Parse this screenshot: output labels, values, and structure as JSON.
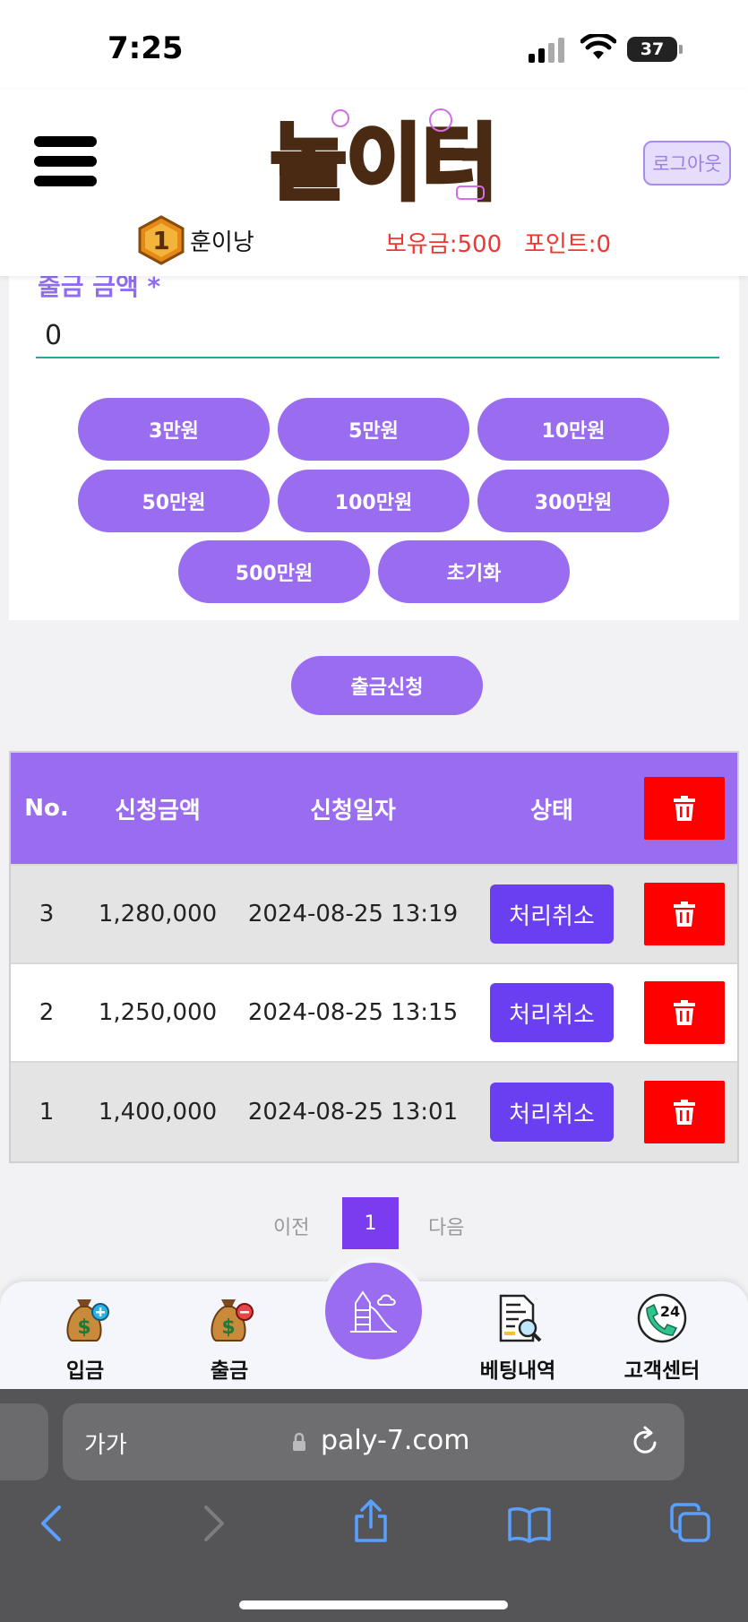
{
  "status_bar": {
    "time": "7:25",
    "battery": "37"
  },
  "header": {
    "logo_text": "놀이터",
    "logout_label": "로그아웃",
    "level": "1",
    "username": "훈이낭",
    "balance": "보유금:500",
    "points": "포인트:0"
  },
  "form": {
    "amount_label": "출금 금액 *",
    "amount_value": "0",
    "quick_amounts": [
      "3만원",
      "5만원",
      "10만원",
      "50만원",
      "100만원",
      "300만원",
      "500만원",
      "초기화"
    ],
    "submit_label": "출금신청"
  },
  "table": {
    "headers": {
      "no": "No.",
      "amount": "신청금액",
      "date": "신청일자",
      "status": "상태"
    },
    "rows": [
      {
        "no": "3",
        "amount": "1,280,000",
        "date": "2024-08-25 13:19",
        "status": "처리취소"
      },
      {
        "no": "2",
        "amount": "1,250,000",
        "date": "2024-08-25 13:15",
        "status": "처리취소"
      },
      {
        "no": "1",
        "amount": "1,400,000",
        "date": "2024-08-25 13:01",
        "status": "처리취소"
      }
    ]
  },
  "pagination": {
    "prev": "이전",
    "current": "1",
    "next": "다음"
  },
  "bottom_nav": {
    "deposit": "입금",
    "withdraw": "출금",
    "bet_history": "베팅내역",
    "support": "고객센터",
    "support_badge": "24"
  },
  "browser": {
    "text_size": "가가",
    "url": "paly-7.com"
  },
  "colors": {
    "accent": "#9a6df0",
    "status_button": "#6a3ff2",
    "danger": "#ff0000",
    "money_text": "#f0362f"
  }
}
